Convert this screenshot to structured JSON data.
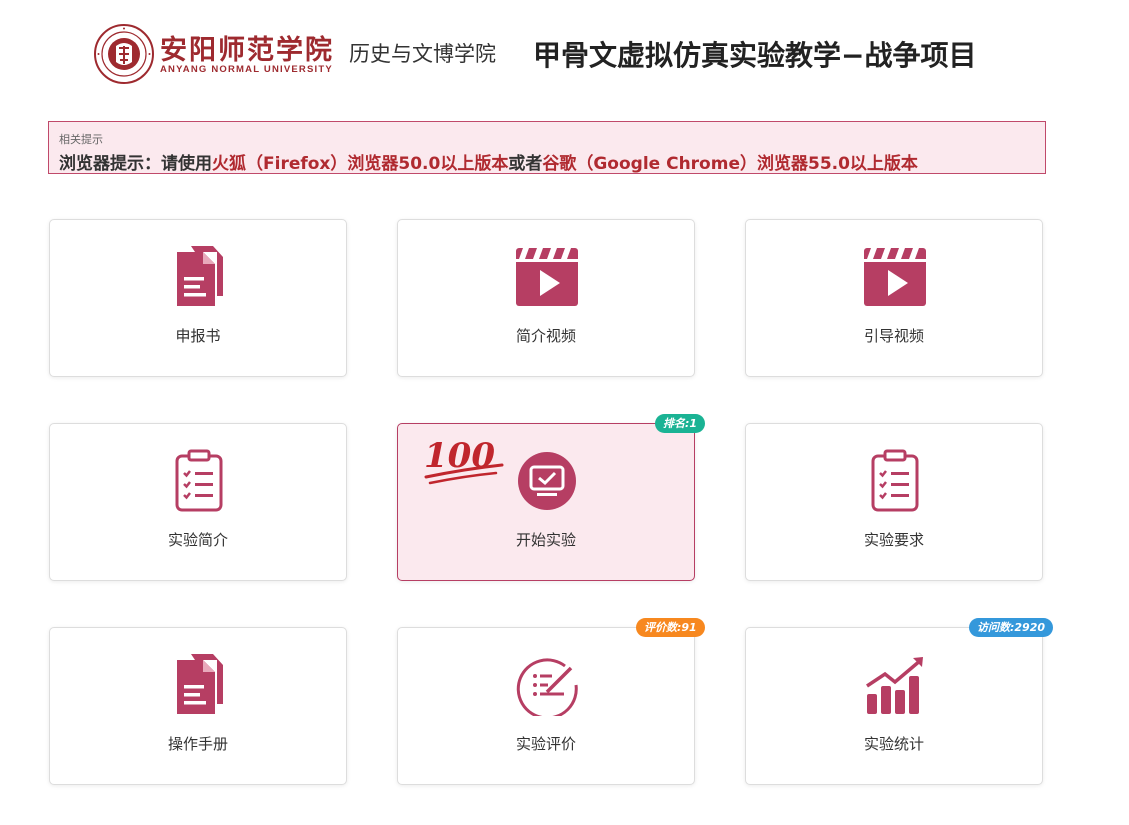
{
  "header": {
    "university_name_cn": "安阳师范学院",
    "university_name_en": "ANYANG NORMAL UNIVERSITY",
    "department": "历史与文博学院",
    "project_title": "甲骨文虚拟仿真实验教学−战争项目"
  },
  "notice": {
    "title": "相关提示",
    "parts": {
      "p1": "浏览器提示：请使用",
      "p2": "火狐（Firefox）浏览器50.0以上版本",
      "p3": "或者",
      "p4": "谷歌（Google Chrome）浏览器55.0以上版本"
    }
  },
  "cards": [
    {
      "label": "申报书",
      "icon": "document-icon"
    },
    {
      "label": "简介视频",
      "icon": "video-icon"
    },
    {
      "label": "引导视频",
      "icon": "video-icon"
    },
    {
      "label": "实验简介",
      "icon": "clipboard-list-icon"
    },
    {
      "label": "开始实验",
      "icon": "monitor-check-icon",
      "active": true
    },
    {
      "label": "实验要求",
      "icon": "clipboard-list-icon"
    },
    {
      "label": "操作手册",
      "icon": "document-icon"
    },
    {
      "label": "实验评价",
      "icon": "evaluate-icon"
    },
    {
      "label": "实验统计",
      "icon": "bar-chart-growth-icon"
    }
  ],
  "badges": {
    "rank": "排名:1",
    "evaluations": "评价数:91",
    "visits": "访问数:2920"
  },
  "decorations": {
    "hundred_text": "100"
  },
  "colors": {
    "accent": "#b63e63",
    "brand_red": "#9e2a2f",
    "notice_bg": "#fbe9ee",
    "badge_green": "#1ab394",
    "badge_orange": "#f7881f",
    "badge_blue": "#3498db"
  }
}
